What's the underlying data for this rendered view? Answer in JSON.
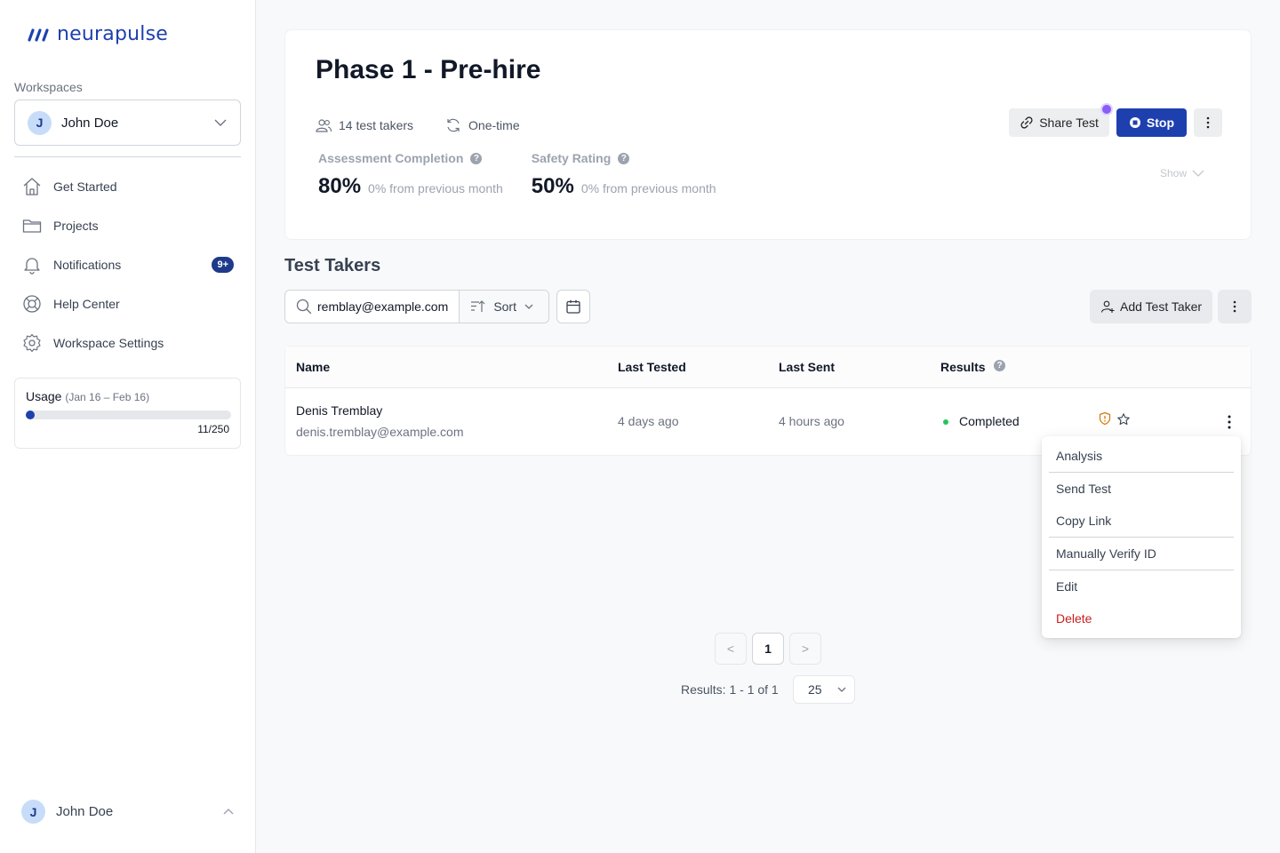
{
  "app": {
    "logo_text": "neurapulse"
  },
  "sidebar": {
    "workspaces_label": "Workspaces",
    "workspace": {
      "avatar_letter": "J",
      "name": "John Doe"
    },
    "items": [
      {
        "label": "Get Started",
        "icon": "home-icon"
      },
      {
        "label": "Projects",
        "icon": "folder-icon"
      },
      {
        "label": "Notifications",
        "icon": "bell-icon",
        "badge": "9+"
      },
      {
        "label": "Help Center",
        "icon": "lifebuoy-icon"
      },
      {
        "label": "Workspace Settings",
        "icon": "gear-icon"
      }
    ],
    "usage": {
      "title": "Usage",
      "range": "(Jan 16 – Feb 16)",
      "count": "11/250",
      "used": 11,
      "total": 250
    },
    "user": {
      "avatar_letter": "J",
      "name": "John Doe"
    }
  },
  "header": {
    "title": "Phase 1 - Pre-hire",
    "test_takers": "14 test takers",
    "frequency": "One-time",
    "stats": [
      {
        "label": "Assessment Completion",
        "value": "80%",
        "sub": "0% from previous month"
      },
      {
        "label": "Safety Rating",
        "value": "50%",
        "sub": "0% from previous month"
      }
    ],
    "share_label": "Share Test",
    "stop_label": "Stop",
    "show_label": "Show"
  },
  "test_takers": {
    "title": "Test Takers",
    "search_value": "remblay@example.com",
    "sort_label": "Sort",
    "add_label": "Add Test Taker",
    "columns": {
      "name": "Name",
      "last_tested": "Last Tested",
      "last_sent": "Last Sent",
      "results": "Results"
    },
    "rows": [
      {
        "name": "Denis Tremblay",
        "email": "denis.tremblay@example.com",
        "last_tested": "4 days ago",
        "last_sent": "4 hours ago",
        "result": "Completed"
      }
    ]
  },
  "row_menu": {
    "analysis": "Analysis",
    "send_test": "Send Test",
    "copy_link": "Copy Link",
    "verify_id": "Manually Verify ID",
    "edit": "Edit",
    "delete": "Delete"
  },
  "pagination": {
    "prev": "<",
    "current": "1",
    "next": ">",
    "results_text": "Results: 1 - 1 of 1",
    "per_page": "25"
  },
  "colors": {
    "brand": "#1e40af",
    "danger": "#c81e1e",
    "success": "#22c55e",
    "accent_dot": "#8b5cf6"
  }
}
